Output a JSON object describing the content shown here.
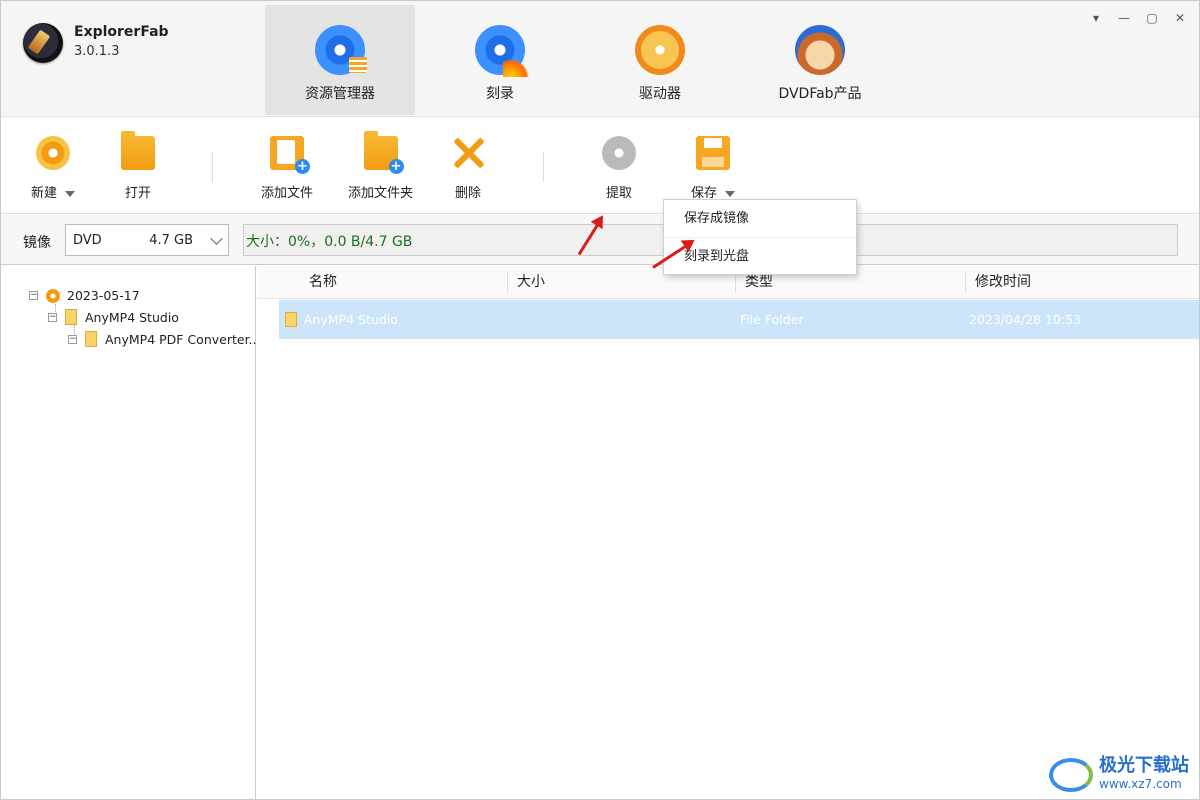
{
  "app": {
    "name": "ExplorerFab",
    "version": "3.0.1.3"
  },
  "tabs": [
    {
      "label": "资源管理器",
      "active": true
    },
    {
      "label": "刻录",
      "active": false
    },
    {
      "label": "驱动器",
      "active": false
    },
    {
      "label": "DVDFab产品",
      "active": false
    }
  ],
  "window_controls": {
    "menu": "▾",
    "minimize": "—",
    "maximize": "▢",
    "close": "✕"
  },
  "toolbar": {
    "new_label": "新建",
    "open_label": "打开",
    "add_file_label": "添加文件",
    "add_folder_label": "添加文件夹",
    "delete_label": "删除",
    "extract_label": "提取",
    "save_label": "保存"
  },
  "save_menu": {
    "items": [
      "保存成镜像",
      "刻录到光盘"
    ]
  },
  "image_bar": {
    "label": "镜像",
    "disc_type": "DVD",
    "disc_capacity": "4.7 GB",
    "capacity_text": "大小：0%，0.0 B/4.7 GB",
    "used_fraction": 0
  },
  "tree": {
    "root": "2023-05-17",
    "child": "AnyMP4 Studio",
    "grandchild": "AnyMP4 PDF Converter..."
  },
  "file_list": {
    "columns": [
      "名称",
      "大小",
      "类型",
      "修改时间"
    ],
    "rows": [
      {
        "name": "AnyMP4 Studio",
        "size": "",
        "type": "File Folder",
        "modified": "2023/04/28 10:53"
      }
    ]
  },
  "watermark": {
    "text": "极光下载站",
    "url": "www.xz7.com"
  },
  "colors": {
    "accent_orange": "#f39c12",
    "selection_blue": "#cce5fb",
    "annotation_red": "#d91c1c",
    "capacity_text": "#1e6e1e"
  }
}
